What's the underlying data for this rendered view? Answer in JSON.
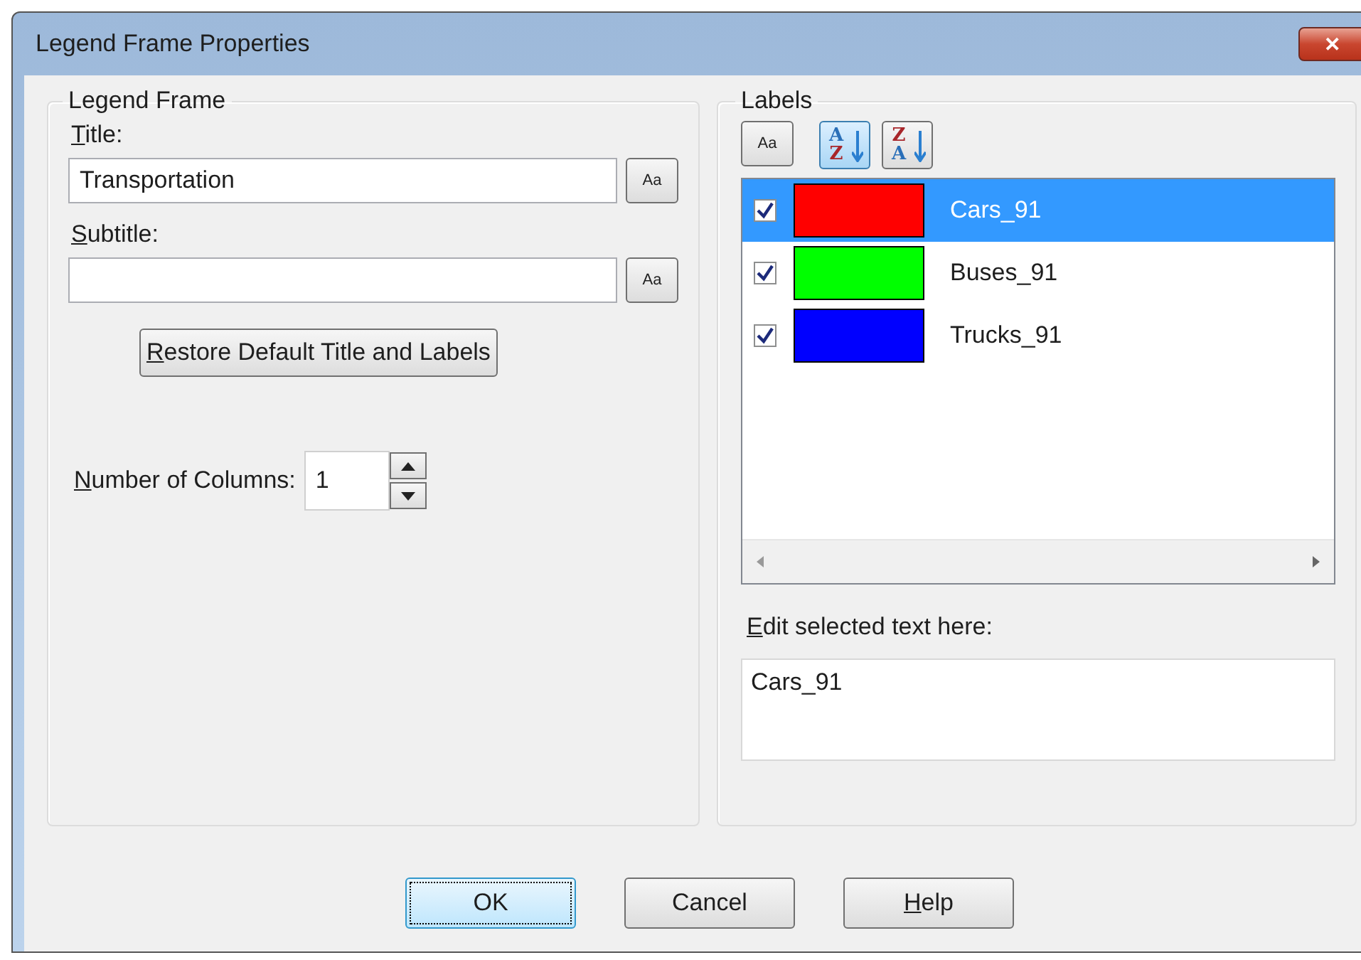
{
  "window": {
    "title": "Legend Frame Properties",
    "close": "✕"
  },
  "legend_frame": {
    "title": "Legend Frame",
    "title_label": {
      "key": "T",
      "rest": "itle:"
    },
    "title_value": "Transportation",
    "title_font_button": "Aa",
    "subtitle_label": {
      "key": "S",
      "rest": "ubtitle:"
    },
    "subtitle_font_button": "Aa",
    "restore_button": {
      "key": "R",
      "rest": "estore Default Title and Labels"
    },
    "columns_label": {
      "key": "N",
      "rest": "umber of Columns:"
    },
    "columns_value": "1"
  },
  "labels": {
    "title": "Labels",
    "font_button": "Aa",
    "sort_buttons": [
      {
        "top": "A",
        "bottom": "Z",
        "selected": true
      },
      {
        "top": "Z",
        "bottom": "A",
        "selected": false
      }
    ],
    "items": [
      {
        "label": "Cars_91",
        "color": "#ff0000",
        "checked": true,
        "selected": true
      },
      {
        "label": "Buses_91",
        "color": "#00ff00",
        "checked": true,
        "selected": false
      },
      {
        "label": "Trucks_91",
        "color": "#0000ff",
        "checked": true,
        "selected": false
      }
    ],
    "edit_label": {
      "key": "E",
      "rest": "dit selected text here:"
    },
    "edit_value": "Cars_91"
  },
  "buttons": [
    {
      "label": {
        "rest": "OK"
      },
      "default": true
    },
    {
      "label": {
        "rest": "Cancel"
      },
      "default": false
    },
    {
      "label": {
        "key": "H",
        "rest": "elp"
      },
      "default": false
    }
  ]
}
